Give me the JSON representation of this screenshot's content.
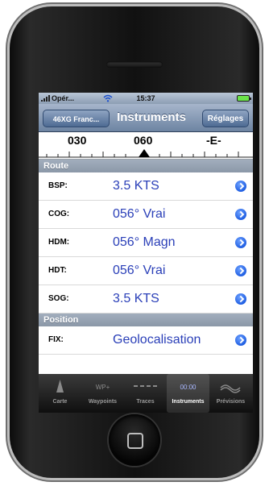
{
  "statusbar": {
    "carrier": "Opér...",
    "time": "15:37"
  },
  "navbar": {
    "back_label": "46XG Franc...",
    "title": "Instruments",
    "settings_label": "Réglages"
  },
  "compass": {
    "labels": [
      "030",
      "060",
      "-E-"
    ]
  },
  "sections": {
    "route": "Route",
    "position": "Position"
  },
  "rows": [
    {
      "label": "BSP:",
      "value": "3.5 KTS"
    },
    {
      "label": "COG:",
      "value": "056° Vrai"
    },
    {
      "label": "HDM:",
      "value": "056° Magn"
    },
    {
      "label": "HDT:",
      "value": "056° Vrai"
    },
    {
      "label": "SOG:",
      "value": "3.5 KTS"
    }
  ],
  "position_rows": [
    {
      "label": "FIX:",
      "value": "Geolocalisation"
    }
  ],
  "tabbar": {
    "tabs": [
      {
        "label": "Carte",
        "icon": "map-pointer-icon"
      },
      {
        "label": "Waypoints",
        "icon_text": "WP+",
        "icon": "waypoints-icon"
      },
      {
        "label": "Traces",
        "icon": "traces-icon"
      },
      {
        "label": "Instruments",
        "icon_text": "00:00",
        "icon": "instruments-icon"
      },
      {
        "label": "Prévisions",
        "icon": "forecast-icon"
      }
    ],
    "selected": "Instruments"
  },
  "colors": {
    "value_text": "#2a3fb8",
    "nav": "#6d84a2",
    "section": "#8b98a8"
  }
}
